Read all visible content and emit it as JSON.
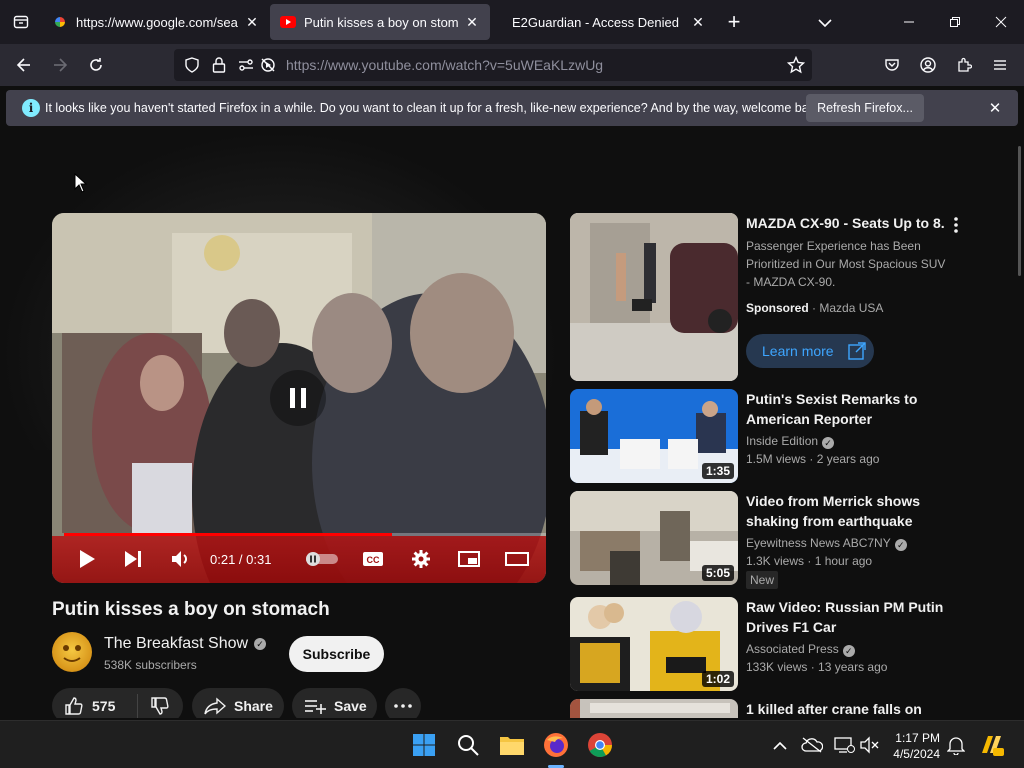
{
  "browser": {
    "tabs": [
      {
        "title": "https://www.google.com/searc",
        "active": false
      },
      {
        "title": "Putin kisses a boy on stomach",
        "active": true
      },
      {
        "title": "E2Guardian - Access Denied",
        "active": false
      }
    ],
    "url": "https://www.youtube.com/watch?v=5uWEaKLzwUg",
    "notification": {
      "message": "It looks like you haven't started Firefox in a while. Do you want to clean it up for a fresh, like-new experience? And by the way, welcome back!",
      "button": "Refresh Firefox..."
    }
  },
  "video": {
    "title": "Putin kisses a boy on stomach",
    "time": "0:21 / 0:31",
    "progress": 0.68,
    "channel": {
      "name": "The Breakfast Show",
      "subscribers": "538K subscribers"
    },
    "subscribe_label": "Subscribe",
    "actions": {
      "likes": "575",
      "share": "Share",
      "save": "Save"
    }
  },
  "recommendations": [
    {
      "title": "MAZDA CX-90 - Seats Up to 8.",
      "description": "Passenger Experience has Been Prioritized in Our Most Spacious SUV - MAZDA CX-90.",
      "sponsored": "Sponsored",
      "advertiser": "Mazda USA",
      "cta": "Learn more"
    },
    {
      "title": "Putin's Sexist Remarks to American Reporter",
      "channel": "Inside Edition",
      "views": "1.5M views",
      "age": "2 years ago",
      "duration": "1:35"
    },
    {
      "title": "Video from Merrick shows shaking from earthquake",
      "channel": "Eyewitness News ABC7NY",
      "views": "1.3K views",
      "age": "1 hour ago",
      "duration": "5:05",
      "badge": "New"
    },
    {
      "title": "Raw Video: Russian PM Putin Drives F1 Car",
      "channel": "Associated Press",
      "views": "133K views",
      "age": "13 years ago",
      "duration": "1:02"
    },
    {
      "title": "1 killed after crane falls on"
    }
  ],
  "taskbar": {
    "time": "1:17 PM",
    "date": "4/5/2024"
  }
}
